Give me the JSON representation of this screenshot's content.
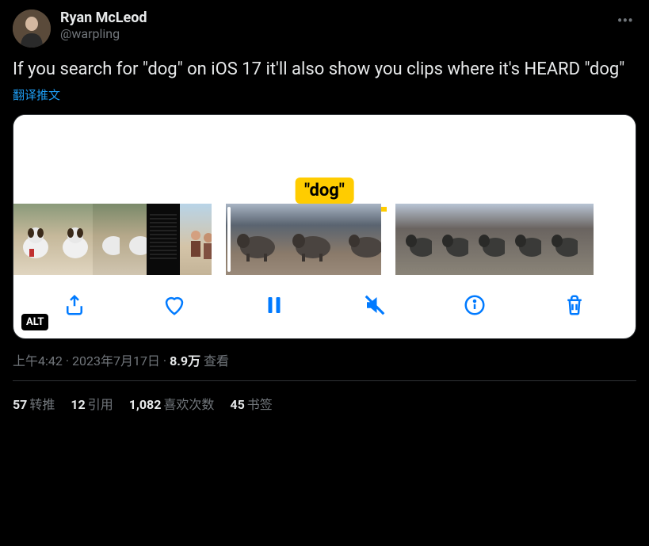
{
  "author": {
    "display_name": "Ryan McLeod",
    "handle": "@warpling"
  },
  "tweet_text": "If you search for \"dog\" on iOS 17 it'll also show you clips where it's HEARD \"dog\"",
  "translate_label": "翻译推文",
  "media": {
    "caption_label": "\"dog\"",
    "alt_badge": "ALT",
    "toolbar": {
      "share": "share",
      "like": "like",
      "pause": "pause",
      "mute": "mute",
      "info": "info",
      "delete": "delete"
    }
  },
  "meta": {
    "time": "上午4:42",
    "date": "2023年7月17日",
    "dot": " · ",
    "views_count": "8.9万",
    "views_label": " 查看"
  },
  "stats": {
    "retweets": {
      "count": "57",
      "label": "转推"
    },
    "quotes": {
      "count": "12",
      "label": "引用"
    },
    "likes": {
      "count": "1,082",
      "label": "喜欢次数"
    },
    "bookmarks": {
      "count": "45",
      "label": "书签"
    }
  }
}
